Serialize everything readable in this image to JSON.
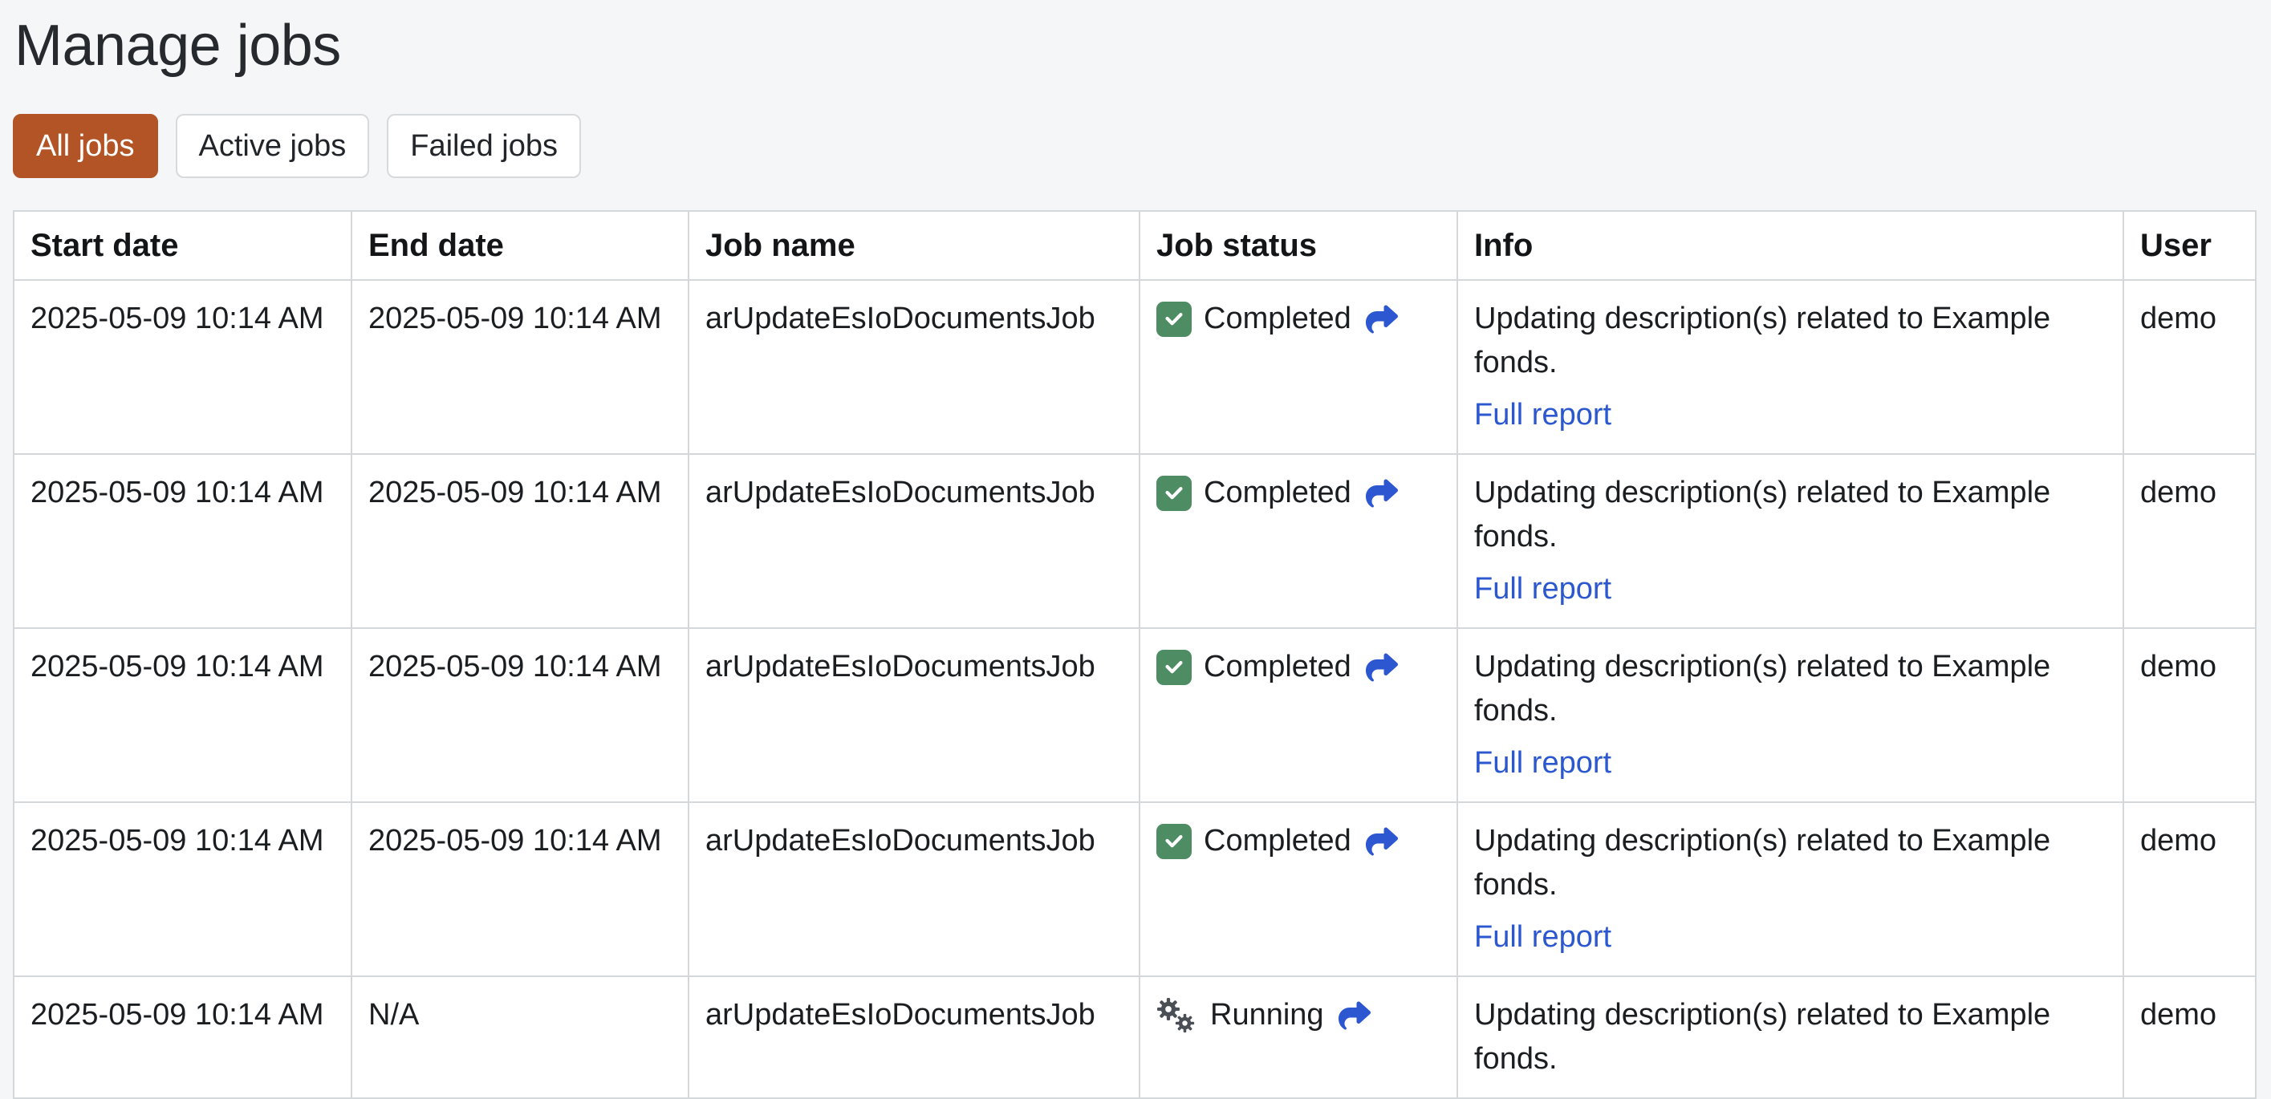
{
  "page": {
    "title": "Manage jobs"
  },
  "filters": [
    {
      "label": "All jobs",
      "active": true
    },
    {
      "label": "Active jobs",
      "active": false
    },
    {
      "label": "Failed jobs",
      "active": false
    }
  ],
  "table": {
    "columns": [
      "Start date",
      "End date",
      "Job name",
      "Job status",
      "Info",
      "User"
    ],
    "rows": [
      {
        "start": "2025-05-09 10:14 AM",
        "end": "2025-05-09 10:14 AM",
        "name": "arUpdateEsIoDocumentsJob",
        "status": "Completed",
        "status_icon": "check-square-icon",
        "action_icon": "share-arrow-icon",
        "info": "Updating description(s) related to Example fonds.",
        "link": "Full report",
        "user": "demo"
      },
      {
        "start": "2025-05-09 10:14 AM",
        "end": "2025-05-09 10:14 AM",
        "name": "arUpdateEsIoDocumentsJob",
        "status": "Completed",
        "status_icon": "check-square-icon",
        "action_icon": "share-arrow-icon",
        "info": "Updating description(s) related to Example fonds.",
        "link": "Full report",
        "user": "demo"
      },
      {
        "start": "2025-05-09 10:14 AM",
        "end": "2025-05-09 10:14 AM",
        "name": "arUpdateEsIoDocumentsJob",
        "status": "Completed",
        "status_icon": "check-square-icon",
        "action_icon": "share-arrow-icon",
        "info": "Updating description(s) related to Example fonds.",
        "link": "Full report",
        "user": "demo"
      },
      {
        "start": "2025-05-09 10:14 AM",
        "end": "2025-05-09 10:14 AM",
        "name": "arUpdateEsIoDocumentsJob",
        "status": "Completed",
        "status_icon": "check-square-icon",
        "action_icon": "share-arrow-icon",
        "info": "Updating description(s) related to Example fonds.",
        "link": "Full report",
        "user": "demo"
      },
      {
        "start": "2025-05-09 10:14 AM",
        "end": "N/A",
        "name": "arUpdateEsIoDocumentsJob",
        "status": "Running",
        "status_icon": "gears-icon",
        "action_icon": "share-arrow-icon",
        "info": "Updating description(s) related to Example fonds.",
        "user": "demo"
      }
    ]
  },
  "colors": {
    "accent_orange": "#b35426",
    "status_green": "#4e8c63",
    "share_arrow_blue": "#2d57d0",
    "link_blue": "#2b57cf",
    "gear_gray": "#4a4f55",
    "table_border": "#d5d8db",
    "page_background": "#f5f6f7"
  }
}
